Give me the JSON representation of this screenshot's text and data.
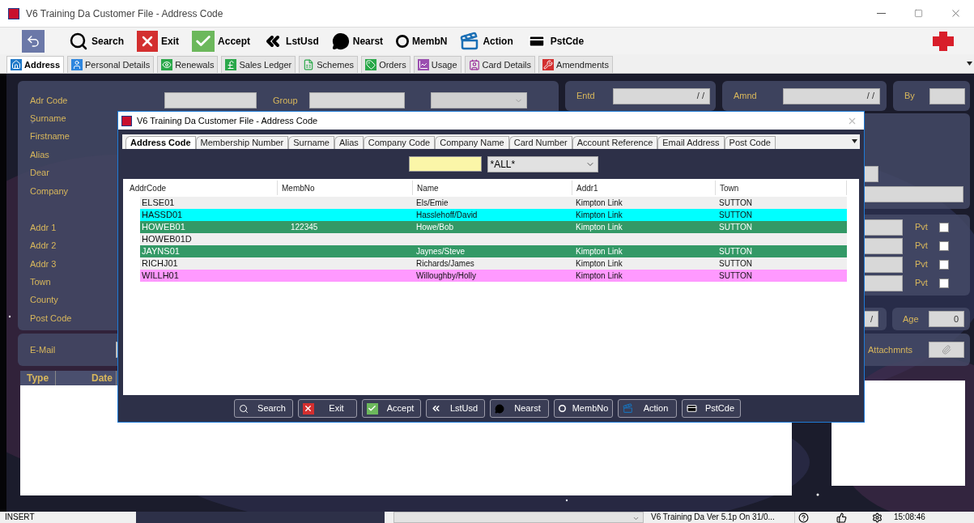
{
  "window": {
    "title": "V6 Training Da Customer File - Address Code"
  },
  "toolbar": [
    "Search",
    "Exit",
    "Accept",
    "LstUsd",
    "Nearst",
    "MembN",
    "Action",
    "PstCde"
  ],
  "tabs": [
    {
      "label": "Address",
      "selected": true
    },
    {
      "label": "Personal Details",
      "selected": false
    },
    {
      "label": "Renewals",
      "selected": false
    },
    {
      "label": "Sales Ledger",
      "selected": false
    },
    {
      "label": "Schemes",
      "selected": false
    },
    {
      "label": "Orders",
      "selected": false
    },
    {
      "label": "Usage",
      "selected": false
    },
    {
      "label": "Card Details",
      "selected": false
    },
    {
      "label": "Amendments",
      "selected": false
    }
  ],
  "form": {
    "labels": [
      "Adr Code",
      "Surname",
      "Firstname",
      "Alias",
      "Dear",
      "Company"
    ],
    "address_labels": [
      "Addr 1",
      "Addr 2",
      "Addr 3",
      "Town",
      "County",
      "Post Code"
    ],
    "group_label": "Group",
    "entd": {
      "label": "Entd",
      "value": "/ /"
    },
    "amnd": {
      "label": "Amnd",
      "value": "/ /"
    },
    "by": {
      "label": "By"
    },
    "pvt": [
      {
        "label": "Pvt",
        "checked": false
      },
      {
        "label": "Pvt",
        "checked": false
      },
      {
        "label": "Pvt",
        "checked": false
      },
      {
        "label": "Pvt",
        "checked": false
      }
    ],
    "date_fragment": "/",
    "age": {
      "label": "Age",
      "value": "0"
    },
    "email_label": "E-Mail",
    "attachments_label": "Attachmnts",
    "history_columns": [
      "Type",
      "Date"
    ]
  },
  "dialog": {
    "title": "V6 Training Da Customer File - Address Code",
    "tabs": [
      {
        "label": "Address Code",
        "selected": true
      },
      {
        "label": "Membership Number",
        "selected": false
      },
      {
        "label": "Surname",
        "selected": false
      },
      {
        "label": "Alias",
        "selected": false
      },
      {
        "label": "Company Code",
        "selected": false
      },
      {
        "label": "Company Name",
        "selected": false
      },
      {
        "label": "Card Number",
        "selected": false
      },
      {
        "label": "Account Reference",
        "selected": false
      },
      {
        "label": "Email Address",
        "selected": false
      },
      {
        "label": "Post Code",
        "selected": false
      }
    ],
    "filter": "*ALL*",
    "columns": [
      "AddrCode",
      "MembNo",
      "Name",
      "Addr1",
      "Town"
    ],
    "rows": [
      {
        "addr_code": "ELSE01",
        "name": "Els/Emie",
        "addr1": "Kimpton Link",
        "town": "SUTTON",
        "color": "#efefef"
      },
      {
        "addr_code": "HASSD01",
        "name": "Hasslehoff/David",
        "addr1": "Kimpton Link",
        "town": "SUTTON",
        "color": "#00ffff"
      },
      {
        "addr_code": "HOWEB01",
        "memb_no": "122345",
        "name": "Howe/Bob",
        "addr1": "Kimpton Link",
        "town": "SUTTON",
        "color": "#339966"
      },
      {
        "addr_code": "HOWEB01D",
        "color": "#efefef"
      },
      {
        "addr_code": "JAYNS01",
        "name": "Jaynes/Steve",
        "addr1": "Kimpton Link",
        "town": "SUTTON",
        "color": "#339966"
      },
      {
        "addr_code": "RICHJ01",
        "name": "Richards/James",
        "addr1": "Kimpton Link",
        "town": "SUTTON",
        "color": "#efefef"
      },
      {
        "addr_code": "WILLH01",
        "name": "Willoughby/Holly",
        "addr1": "Kimpton Link",
        "town": "SUTTON",
        "color": "#ff99ff"
      }
    ],
    "buttons": [
      "Search",
      "Exit",
      "Accept",
      "LstUsd",
      "Nearst",
      "MembNo",
      "Action",
      "PstCde"
    ]
  },
  "status_bar": {
    "mode": "INSERT",
    "version": "V6 Training Da Ver 5.1p On 31/0...",
    "time": "15:08:46"
  }
}
